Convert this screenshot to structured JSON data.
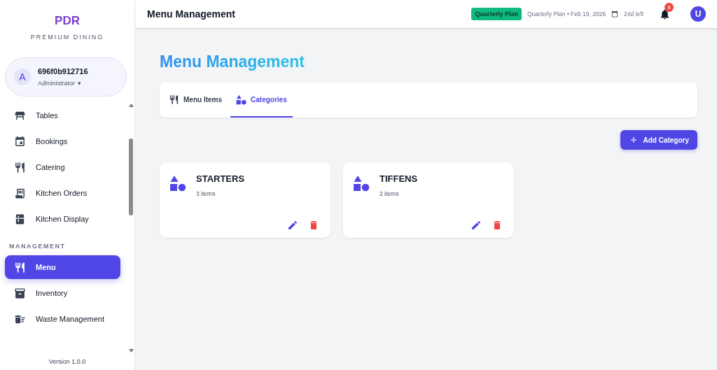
{
  "sidebar": {
    "logo": "PDR",
    "tagline": "PREMIUM DINING",
    "user": {
      "avatar": "A",
      "name": "696f0b912716",
      "role": "Administrator",
      "caret": "▾"
    },
    "items": [
      {
        "label": "Tables",
        "selected": false
      },
      {
        "label": "Bookings",
        "selected": false
      },
      {
        "label": "Catering",
        "selected": false
      },
      {
        "label": "Kitchen Orders",
        "selected": false
      },
      {
        "label": "Kitchen Display",
        "selected": false
      }
    ],
    "section": "MANAGEMENT",
    "section_items": [
      {
        "label": "Menu",
        "selected": true
      },
      {
        "label": "Inventory",
        "selected": false
      },
      {
        "label": "Waste Management",
        "selected": false
      }
    ],
    "version": "Version 1.0.0"
  },
  "header": {
    "title": "Menu Management",
    "plan_badge": "Quarterly Plan",
    "plan_info": "Quarterly Plan • Feb 19, 2026",
    "days_left": "24d left",
    "notifications": "8",
    "avatar": "U"
  },
  "page": {
    "title": "Menu Management",
    "tabs": [
      {
        "label": "Menu Items",
        "selected": false
      },
      {
        "label": "Categories",
        "selected": true
      }
    ],
    "add_button": "Add Category",
    "categories": [
      {
        "name": "STARTERS",
        "count": "3 items"
      },
      {
        "name": "TIFFENS",
        "count": "2 items"
      }
    ]
  }
}
